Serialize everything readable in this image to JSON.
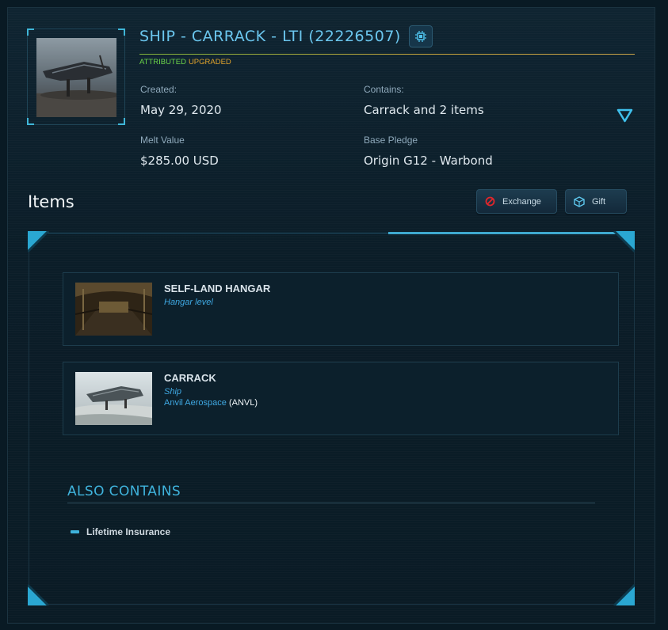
{
  "pledge": {
    "title": "SHIP - CARRACK - LTI (22226507)",
    "status_attributed": "ATTRIBUTED",
    "status_upgraded": "UPGRADED",
    "thumbnail_icon": "ship-thumbnail-icon",
    "chip_icon": "chip-icon"
  },
  "details": {
    "created_label": "Created:",
    "created_value": "May 29, 2020",
    "contains_label": "Contains:",
    "contains_value": "Carrack and 2 items",
    "melt_label": "Melt Value",
    "melt_value": "$285.00 USD",
    "base_label": "Base Pledge",
    "base_value": "Origin G12 - Warbond"
  },
  "items_section": {
    "heading": "Items",
    "exchange_label": "Exchange",
    "gift_label": "Gift",
    "items": [
      {
        "name": "SELF-LAND HANGAR",
        "type": "Hangar level",
        "manufacturer": "",
        "manufacturer_code": "",
        "image_icon": "hangar-image"
      },
      {
        "name": "CARRACK",
        "type": "Ship",
        "manufacturer": "Anvil Aerospace",
        "manufacturer_code": "(ANVL)",
        "image_icon": "carrack-image"
      }
    ]
  },
  "also_contains": {
    "heading": "ALSO CONTAINS",
    "items": [
      "Lifetime Insurance"
    ]
  },
  "colors": {
    "accent": "#3fb3dc",
    "title": "#6bc6ee",
    "attributed": "#6dd64a",
    "upgraded": "#e1a32c",
    "background": "#091a24"
  }
}
